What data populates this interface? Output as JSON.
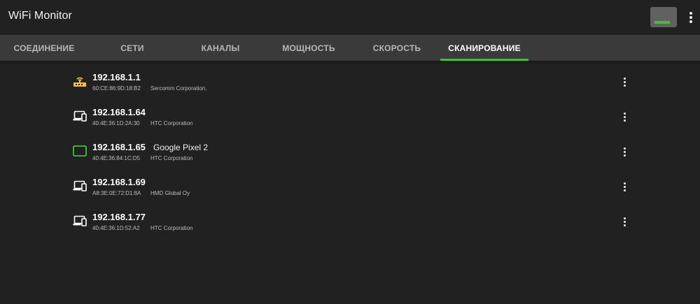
{
  "app": {
    "title": "WiFi Monitor",
    "accent_color": "#4cbb3c",
    "signal_level": 0.85
  },
  "tabs": [
    {
      "label": "СОЕДИНЕНИЕ",
      "active": false
    },
    {
      "label": "СЕТИ",
      "active": false
    },
    {
      "label": "КАНАЛЫ",
      "active": false
    },
    {
      "label": "МОЩНОСТЬ",
      "active": false
    },
    {
      "label": "СКОРОСТЬ",
      "active": false
    },
    {
      "label": "СКАНИРОВАНИЕ",
      "active": true
    }
  ],
  "devices": [
    {
      "ip": "192.168.1.1",
      "name": "",
      "mac": "60:CE:86:9D:18:B2",
      "vendor": "Sercomm Corporation.",
      "icon": "router-icon",
      "icon_color": "#f2c230"
    },
    {
      "ip": "192.168.1.64",
      "name": "",
      "mac": "40:4E:36:1D:2A:30",
      "vendor": "HTC Corporation",
      "icon": "devices-icon",
      "icon_color": "#ffffff"
    },
    {
      "ip": "192.168.1.65",
      "name": "Google Pixel 2",
      "mac": "40:4E:36:84:1C:D5",
      "vendor": "HTC Corporation",
      "icon": "tablet-icon",
      "icon_color": "#4cbb3c"
    },
    {
      "ip": "192.168.1.69",
      "name": "",
      "mac": "A8:3E:0E:72:D1:8A",
      "vendor": "HMD Global Oy",
      "icon": "devices-icon",
      "icon_color": "#ffffff"
    },
    {
      "ip": "192.168.1.77",
      "name": "",
      "mac": "40:4E:36:1D:52:A2",
      "vendor": "HTC Corporation",
      "icon": "devices-icon",
      "icon_color": "#ffffff"
    }
  ]
}
